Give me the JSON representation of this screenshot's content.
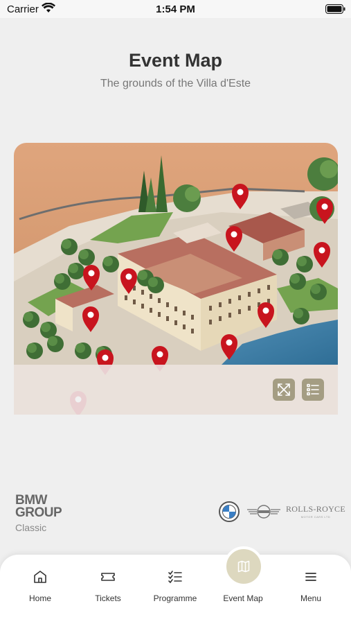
{
  "status_bar": {
    "carrier": "Carrier",
    "time": "1:54 PM"
  },
  "header": {
    "title": "Event Map",
    "subtitle": "The grounds of the Villa d'Este"
  },
  "map": {
    "expand_icon": "expand-icon",
    "list_icon": "list-view-icon",
    "marker_color": "#c8141e",
    "button_color": "#a49d83"
  },
  "footer": {
    "brand_line1": "BMW",
    "brand_line2": "GROUP",
    "brand_line3": "Classic",
    "rolls_royce": "ROLLS-ROYCE",
    "rolls_royce_sub": "MOTOR CARS LTD"
  },
  "tabs": [
    {
      "label": "Home",
      "icon": "home-icon"
    },
    {
      "label": "Tickets",
      "icon": "ticket-icon"
    },
    {
      "label": "Programme",
      "icon": "checklist-icon"
    },
    {
      "label": "Event Map",
      "icon": "map-icon",
      "active": true
    },
    {
      "label": "Menu",
      "icon": "menu-icon"
    }
  ],
  "colors": {
    "active_tab_bg": "#ddd8bf",
    "background": "#efefef"
  }
}
